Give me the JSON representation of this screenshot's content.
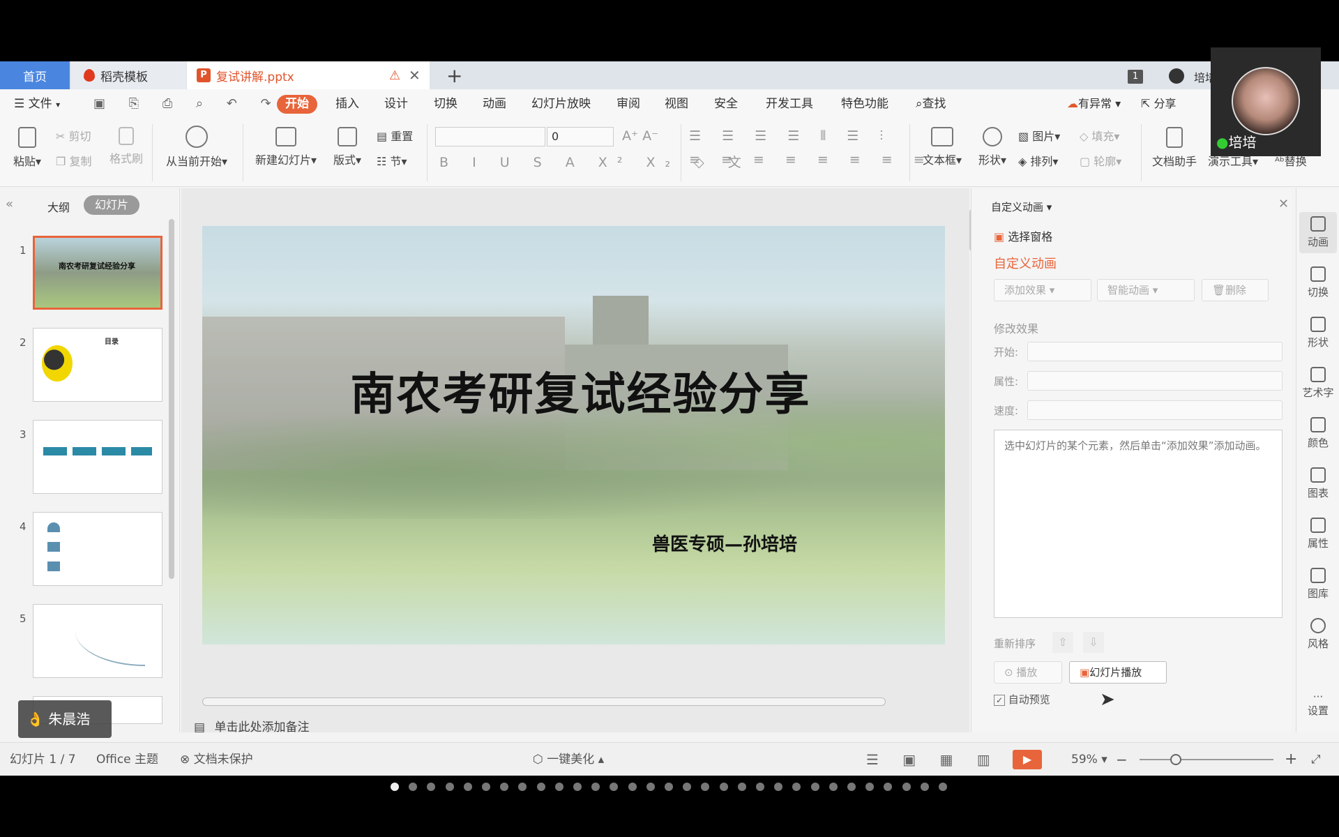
{
  "tabs": {
    "home": "首页",
    "daoke": "稻壳模板",
    "doc": "复试讲解.pptx",
    "badge": "1",
    "user": "培培"
  },
  "menu": {
    "file": "文件",
    "items": [
      "开始",
      "插入",
      "设计",
      "切换",
      "动画",
      "幻灯片放映",
      "审阅",
      "视图",
      "安全",
      "开发工具",
      "特色功能"
    ],
    "search": "查找",
    "abnormal": "有异常",
    "share": "分享"
  },
  "ribbon": {
    "paste": "粘贴",
    "cut": "剪切",
    "copy": "复制",
    "format_painter": "格式刷",
    "play_from": "从当前开始",
    "new_slide": "新建幻灯片",
    "layout": "版式",
    "reset": "重置",
    "section": "节",
    "font_size": "0",
    "textbox": "文本框",
    "shape": "形状",
    "picture": "图片",
    "arrange": "排列",
    "fill": "填充",
    "outline": "轮廓",
    "doc_assist": "文档助手",
    "present_tools": "演示工具",
    "replace": "替换"
  },
  "left": {
    "outline": "大纲",
    "slides": "幻灯片",
    "nums": [
      "1",
      "2",
      "3",
      "4",
      "5"
    ]
  },
  "slide": {
    "title": "南农考研复试经验分享",
    "subtitle": "兽医专硕—孙培培"
  },
  "thumbs": {
    "t1": "南农考研复试经验分享",
    "t2": "目录"
  },
  "notes": "单击此处添加备注",
  "panel": {
    "title": "自定义动画",
    "select_pane": "选择窗格",
    "section": "自定义动画",
    "add_effect": "添加效果",
    "smart_anim": "智能动画",
    "delete": "删除",
    "modify": "修改效果",
    "start": "开始:",
    "property": "属性:",
    "speed": "速度:",
    "hint": "选中幻灯片的某个元素，然后单击“添加效果”添加动画。",
    "reorder": "重新排序",
    "play": "播放",
    "slideshow": "幻灯片播放",
    "auto_preview": "自动预览"
  },
  "sidebar": [
    "动画",
    "切换",
    "形状",
    "艺术字",
    "颜色",
    "图表",
    "属性",
    "图库",
    "风格",
    "设置"
  ],
  "status": {
    "slide_info": "幻灯片 1 / 7",
    "theme": "Office 主题",
    "protect": "文档未保护",
    "beautify": "一键美化",
    "zoom": "59%"
  },
  "webcam": {
    "name": "培培"
  },
  "participant": "朱晨浩",
  "colors": {
    "accent": "#e8643a",
    "tab_home": "#4a86e0",
    "play": "#e8643a"
  }
}
